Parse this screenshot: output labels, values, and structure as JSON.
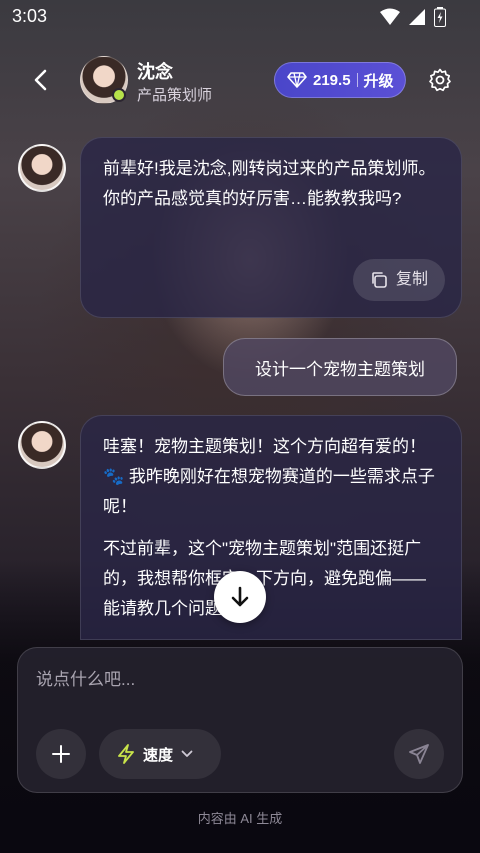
{
  "status_bar": {
    "time": "3:03"
  },
  "header": {
    "name": "沈念",
    "role": "产品策划师",
    "coins": "219.5",
    "upgrade_label": "升级"
  },
  "messages": [
    {
      "sender": "ai",
      "paragraphs": [
        "前辈好!我是沈念,刚转岗过来的产品策划师。你的产品感觉真的好厉害…能教教我吗?"
      ],
      "copy_label": "复制"
    },
    {
      "sender": "user",
      "text": "设计一个宠物主题策划"
    },
    {
      "sender": "ai",
      "paragraphs": [
        "哇塞！宠物主题策划！这个方向超有爱的！🐾 我昨晚刚好在想宠物赛道的一些需求点子呢！",
        "不过前辈，这个\"宠物主题策划\"范围还挺广的，我想帮你框定一下方向，避免跑偏——能请教几个问题吗?"
      ]
    }
  ],
  "composer": {
    "placeholder": "说点什么吧...",
    "speed_label": "速度"
  },
  "footer": {
    "notice": "内容由 AI 生成"
  },
  "colors": {
    "accent": "#5b50d6",
    "online": "#b7e24a"
  },
  "icons": [
    "back-arrow-icon",
    "diamond-icon",
    "gear-icon",
    "copy-icon",
    "arrow-down-icon",
    "plus-icon",
    "lightning-icon",
    "chevron-down-icon",
    "send-icon",
    "wifi-icon",
    "signal-icon",
    "battery-icon"
  ]
}
